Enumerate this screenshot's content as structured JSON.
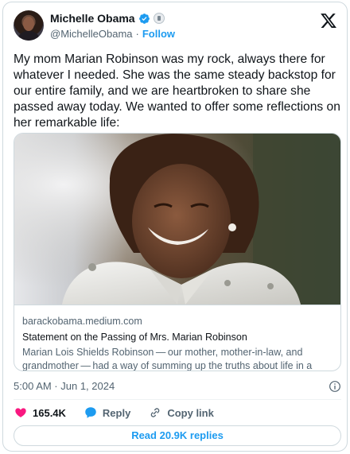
{
  "author": {
    "display_name": "Michelle Obama",
    "handle": "@MichelleObama",
    "separator": "·",
    "follow_label": "Follow",
    "avatar_icon": "profile-photo",
    "verified_icon": "verified-badge-icon",
    "affiliation_icon": "government-seal-icon"
  },
  "platform_icon": "x-logo-icon",
  "tweet": {
    "text": "My mom Marian Robinson was my rock, always there for whatever I needed. She was the same steady backstop for our entire family, and we are heartbroken to share she passed away today. We wanted to offer some reflections on her remarkable life:"
  },
  "link_card": {
    "image": "photo of smiling woman in white shirt",
    "domain": "barackobama.medium.com",
    "title": "Statement on the Passing of Mrs. Marian Robinson",
    "description": "Marian Lois Shields Robinson — our mother, mother-in-law, and grandmother — had a way of summing up the truths about life in a word..."
  },
  "timestamp": "5:00 AM · Jun 1, 2024",
  "info_icon": "info-icon",
  "actions": {
    "likes_count": "165.4K",
    "reply_label": "Reply",
    "copy_link_label": "Copy link"
  },
  "read_replies_label": "Read 20.9K replies",
  "colors": {
    "accent": "#1d9bf0",
    "like": "#f91880",
    "text": "#0f1419",
    "muted": "#536471",
    "border": "#cfd9de"
  }
}
